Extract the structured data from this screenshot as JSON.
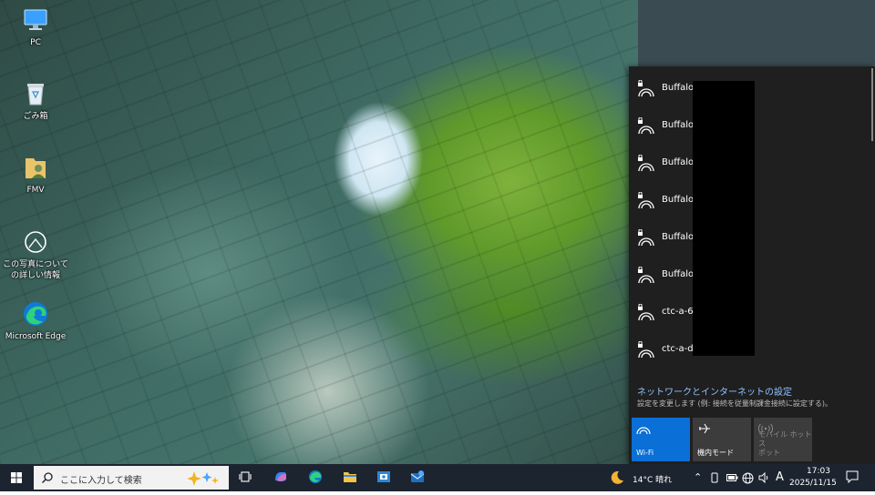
{
  "desktop": {
    "icons": [
      {
        "label": "PC"
      },
      {
        "label": "ごみ箱"
      },
      {
        "label": "FMV"
      },
      {
        "label": "この写真についての詳しい情報"
      },
      {
        "label": "Microsoft Edge"
      }
    ]
  },
  "network_flyout": {
    "networks": [
      {
        "ssid": "Buffalo"
      },
      {
        "ssid": "Buffalo"
      },
      {
        "ssid": "Buffalo"
      },
      {
        "ssid": "Buffalo"
      },
      {
        "ssid": "Buffalo"
      },
      {
        "ssid": "Buffalo"
      },
      {
        "ssid": "ctc-a-6"
      },
      {
        "ssid": "ctc-a-d"
      }
    ],
    "settings_link": "ネットワークとインターネットの設定",
    "settings_subtext": "設定を変更します (例: 接続を従量制課金接続に設定する)。",
    "quick_actions": {
      "wifi": "Wi-Fi",
      "airplane": "機内モード",
      "hotspot_line1": "モバイル ホットス",
      "hotspot_line2": "ポット"
    }
  },
  "taskbar": {
    "search_placeholder": "ここに入力して検索",
    "weather": "14°C  晴れ",
    "ime_mode": "A",
    "clock_time": "17:03",
    "clock_date": "2025/11/15"
  },
  "colors": {
    "accent": "#0a6fd6",
    "link": "#8ec2ff",
    "flyout_bg": "#1f1f1f",
    "taskbar_bg": "#1c2430"
  }
}
